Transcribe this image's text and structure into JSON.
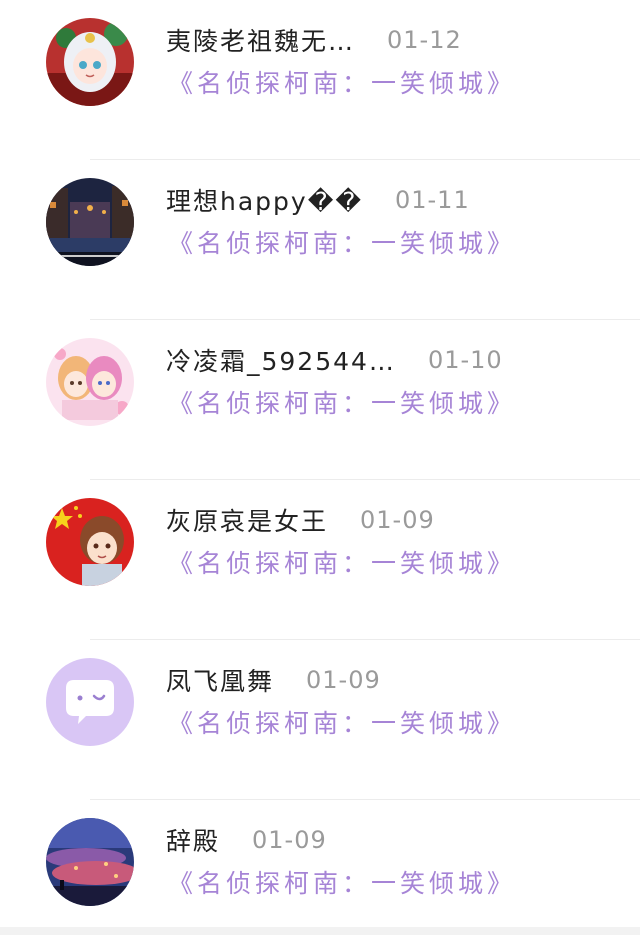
{
  "items": [
    {
      "username": "夷陵老祖魏无…",
      "date": "01-12",
      "book": "《名侦探柯南：一笑倾城》",
      "avatar": "anime-girl-white-hair-avatar"
    },
    {
      "username": "理想happy��",
      "date": "01-11",
      "book": "《名侦探柯南：一笑倾城》",
      "avatar": "night-street-scene-avatar"
    },
    {
      "username": "冷凌霜_592544…",
      "date": "01-10",
      "book": "《名侦探柯南：一笑倾城》",
      "avatar": "two-anime-girls-avatar"
    },
    {
      "username": "灰原哀是女王",
      "date": "01-09",
      "book": "《名侦探柯南：一笑倾城》",
      "avatar": "flag-anime-boy-avatar"
    },
    {
      "username": "凤飞凰舞",
      "date": "01-09",
      "book": "《名侦探柯南：一笑倾城》",
      "avatar": "default-chat-bubble-avatar"
    },
    {
      "username": "辞殿",
      "date": "01-09",
      "book": "《名侦探柯南：一笑倾城》",
      "avatar": "sunset-sky-avatar"
    }
  ],
  "colors": {
    "book_title": "#a684d6",
    "date": "#9a9a9a",
    "username": "#222222",
    "default_avatar_bg": "#d9c6f5"
  }
}
